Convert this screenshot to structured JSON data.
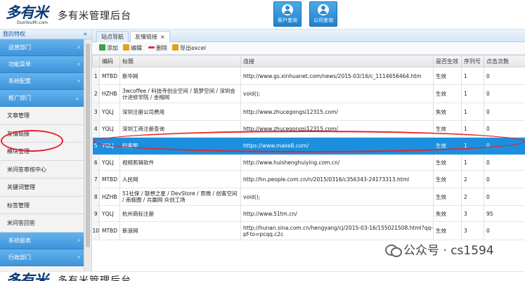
{
  "header": {
    "logo_text": "多有米",
    "logo_sub": "DuoYouMi.com",
    "app_title": "多有米管理后台",
    "nav": [
      {
        "label": "客户查询",
        "icon": "user-search-icon"
      },
      {
        "label": "公司查询",
        "icon": "company-search-icon"
      }
    ]
  },
  "sidebar": {
    "title": "我的特权",
    "collapse_symbol": "«",
    "groups_top": [
      "运营部门",
      "功能菜单",
      "系统配置",
      "推广部门"
    ],
    "items": [
      "文章管理",
      "友情链接",
      "模块管理",
      "米问答审核中心",
      "关键词管理",
      "标签管理",
      "米问答回答"
    ],
    "groups_bottom": [
      "系统报表",
      "行政部门"
    ]
  },
  "tabs": [
    {
      "label": "站点导航",
      "active": false
    },
    {
      "label": "友情链接",
      "active": true,
      "close": "×"
    }
  ],
  "toolbar": {
    "add": "添加",
    "edit": "编辑",
    "delete": "删除",
    "export": "导出excel"
  },
  "table": {
    "columns": [
      "",
      "编码",
      "标题",
      "连接",
      "是否生效",
      "序列号",
      "点击次数"
    ],
    "rows": [
      {
        "n": "1",
        "code": "MTBD",
        "title": "新华网",
        "url": "http://www.gs.xinhuanet.com/news/2015-03/16/c_1114656464.htm",
        "status": "生效",
        "seq": "1",
        "clicks": "0"
      },
      {
        "n": "2",
        "code": "HZHB",
        "title": "3wcoffee / 科技寺创业空间 / 筑梦空间 / 深圳会计进修学院 / 金榕网",
        "url": "void();",
        "status": "生效",
        "seq": "1",
        "clicks": "0"
      },
      {
        "n": "3",
        "code": "YQLJ",
        "title": "深圳注册公司费用",
        "url": "http://www.zhucegongsi12315.com/",
        "status": "失效",
        "seq": "1",
        "clicks": "0"
      },
      {
        "n": "4",
        "code": "YQLJ",
        "title": "深圳工商注册查询",
        "url": "http://www.zhucegongsi12315.com/",
        "status": "生效",
        "seq": "1",
        "clicks": "0"
      },
      {
        "n": "5",
        "code": "YQLJ",
        "title": "码客帮",
        "url": "https://www.make8.com/",
        "status": "生效",
        "seq": "1",
        "clicks": "0"
      },
      {
        "n": "6",
        "code": "YQLJ",
        "title": "视频剪辑软件",
        "url": "http://www.huishenghuiying.com.cn/",
        "status": "生效",
        "seq": "1",
        "clicks": "0"
      },
      {
        "n": "7",
        "code": "MTBD",
        "title": "人民网",
        "url": "http://hn.people.com.cn/n/2015/0316/c356343-24173313.html",
        "status": "生效",
        "seq": "2",
        "clicks": "0"
      },
      {
        "n": "8",
        "code": "HZHB",
        "title": "51社保 / 联想之星 / DevStore / 思微 / 创客空间 / 南极圈 / 共赢网 众创工场",
        "url": "void();",
        "status": "生效",
        "seq": "2",
        "clicks": "0"
      },
      {
        "n": "9",
        "code": "YQLJ",
        "title": "杭州商标注册",
        "url": "http://www.51tm.cn/",
        "status": "失效",
        "seq": "3",
        "clicks": "95"
      },
      {
        "n": "10",
        "code": "MTBD",
        "title": "新浪网",
        "url": "http://hunan.sina.com.cn/hengyang/cj/2015-03-16/155021508.html?qq-pf-to=pcqq.c2c",
        "status": "生效",
        "seq": "3",
        "clicks": "0"
      }
    ]
  },
  "watermark": "公众号 · cs1594"
}
